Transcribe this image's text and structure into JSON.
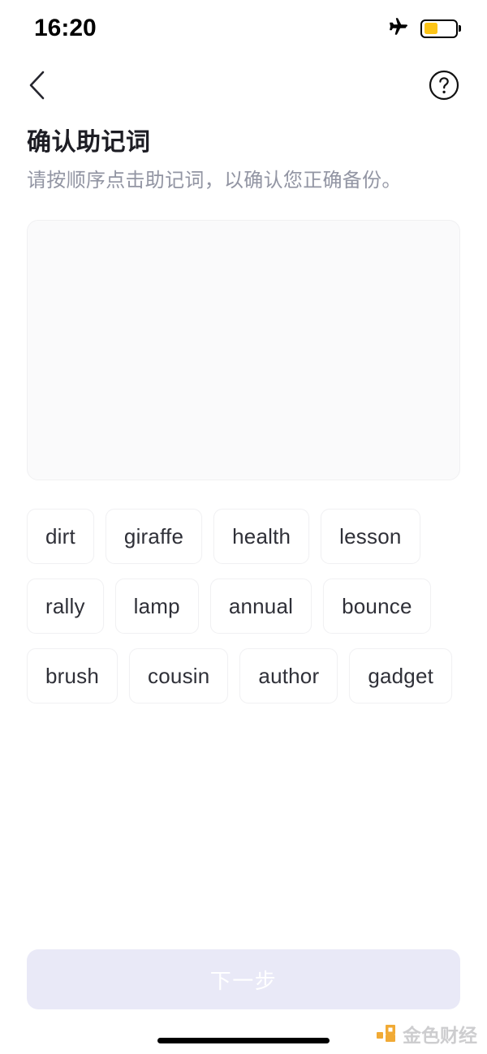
{
  "status_bar": {
    "time": "16:20",
    "airplane_icon": "airplane-mode-icon",
    "battery_icon": "battery-icon",
    "battery_level_percent": 45,
    "battery_color": "#FCC417"
  },
  "nav_bar": {
    "back_icon": "chevron-left-icon",
    "help_icon": "question-mark-circle-icon"
  },
  "header": {
    "title": "确认助记词",
    "subtitle": "请按顺序点击助记词，以确认您正确备份。"
  },
  "answer_panel": {
    "selected_words": []
  },
  "word_pool": {
    "words": [
      "dirt",
      "giraffe",
      "health",
      "lesson",
      "rally",
      "lamp",
      "annual",
      "bounce",
      "brush",
      "cousin",
      "author",
      "gadget"
    ]
  },
  "footer": {
    "next_label": "下一步",
    "next_disabled": true,
    "next_bg_color": "#E9E9F7"
  },
  "watermark": {
    "text": "金色财经",
    "logo_icon": "jinse-finance-logo-icon",
    "logo_color": "#F0A324"
  }
}
